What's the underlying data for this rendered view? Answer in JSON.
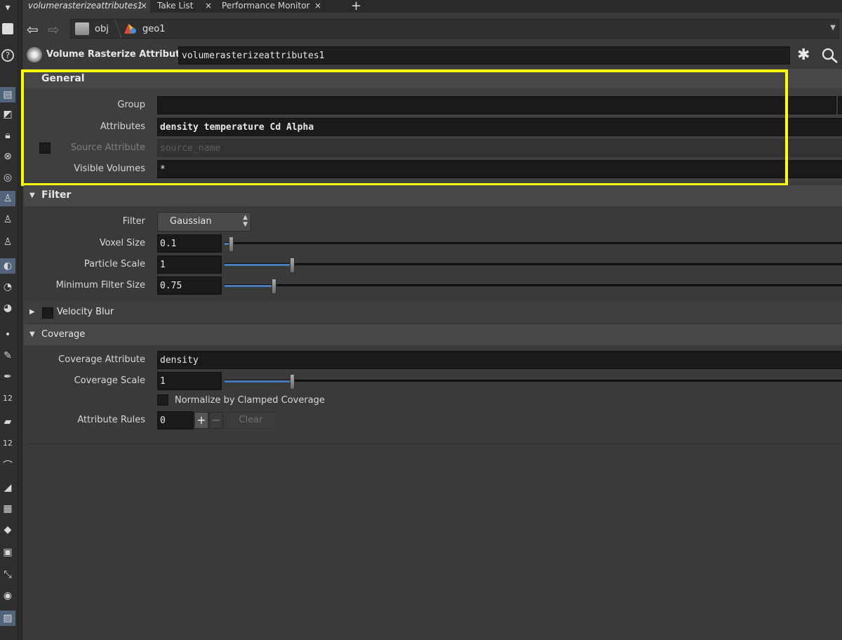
{
  "tabs": [
    {
      "label": "volumerasterizeattributes1",
      "close": "×"
    },
    {
      "label": "Take List",
      "close": "×"
    },
    {
      "label": "Performance Monitor",
      "close": "×"
    }
  ],
  "tab_add": "+",
  "nav": {
    "back": "⇦",
    "forward": "⇨",
    "path": [
      "obj",
      "geo1"
    ],
    "dropdown": "▼"
  },
  "node": {
    "type": "Volume Rasterize Attributes",
    "name": "volumerasterizeattributes1"
  },
  "sections": {
    "general": {
      "title": "General",
      "group_label": "Group",
      "group_value": "",
      "attributes_label": "Attributes",
      "attributes_value": "density temperature Cd Alpha",
      "source_attribute_label": "Source Attribute",
      "source_attribute_placeholder": "source_name",
      "visible_volumes_label": "Visible Volumes",
      "visible_volumes_value": "*"
    },
    "filter": {
      "title": "Filter",
      "filter_label": "Filter",
      "filter_value": "Gaussian",
      "voxel_size_label": "Voxel Size",
      "voxel_size_value": "0.1",
      "particle_scale_label": "Particle Scale",
      "particle_scale_value": "1",
      "min_filter_label": "Minimum Filter Size",
      "min_filter_value": "0.75"
    },
    "velocity_blur": {
      "title": "Velocity Blur"
    },
    "coverage": {
      "title": "Coverage",
      "coverage_attribute_label": "Coverage Attribute",
      "coverage_attribute_value": "density",
      "coverage_scale_label": "Coverage Scale",
      "coverage_scale_value": "1",
      "normalize_label": "Normalize by Clamped Coverage",
      "attribute_rules_label": "Attribute Rules",
      "attribute_rules_value": "0",
      "add": "+",
      "remove": "−",
      "clear": "Clear"
    }
  },
  "sliders": {
    "voxel_size_fraction": 0.01,
    "particle_scale_fraction": 0.109,
    "min_filter_fraction": 0.079,
    "coverage_scale_fraction": 0.109
  },
  "colors": {
    "highlight": "#ffff00",
    "slider_fill": "#4a7ab8",
    "selected_tool": "#52637c"
  },
  "left_tools": [
    "pointer-icon",
    "help-icon",
    "view-icon",
    "select-icon",
    "lock-icon",
    "x-ray-icon",
    "ghost-icon",
    "light-icon",
    "light-bulb-icon",
    "light-stand-icon",
    "handle-icon",
    "eye-icon",
    "camera-eye-icon",
    "point-icon",
    "brush-icon",
    "pen-icon",
    "number-icon",
    "paint-icon",
    "number-icon-2",
    "curve-icon",
    "surface-icon",
    "checker-icon",
    "diamond-icon",
    "frame-icon",
    "link-icon",
    "circle-icon",
    "image-icon"
  ],
  "left_numbers": {
    "n1": "12",
    "n2": "12"
  }
}
